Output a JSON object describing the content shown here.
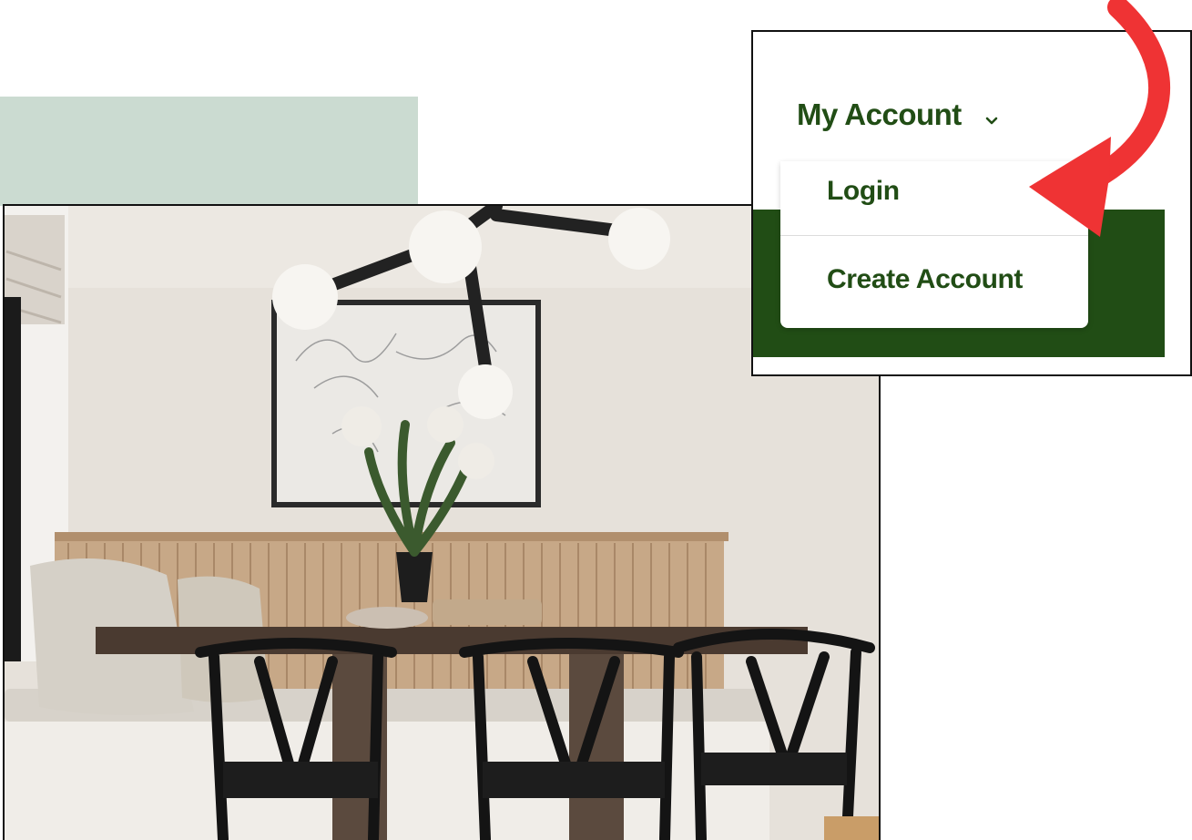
{
  "account_menu": {
    "title": "My Account",
    "items": [
      {
        "label": "Login"
      },
      {
        "label": "Create Account"
      }
    ]
  },
  "colors": {
    "brand_green": "#214d15",
    "sage": "#cbdbd1",
    "arrow_red": "#ef3334"
  },
  "icons": [
    "chevron-down-icon",
    "curved-arrow-icon"
  ]
}
